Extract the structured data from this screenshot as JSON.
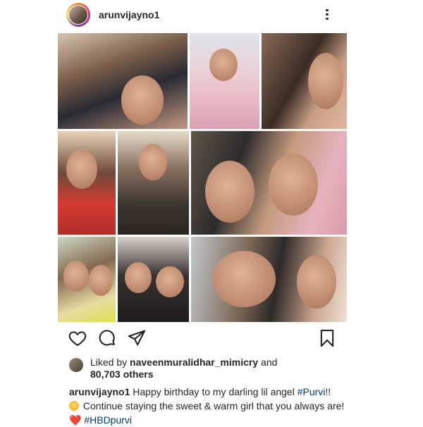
{
  "post": {
    "username": "arunvijayno1",
    "liked_by_prefix": "Liked by",
    "liked_by_user": "naveenmuralidhar_mimicry",
    "liked_by_and": "and",
    "others": "80,703 others",
    "caption": {
      "username": "arunvijayno1",
      "text1": "Happy birthday to my darling lil angel",
      "hashtag1": "#Purvi!!",
      "text2": "Continue staying the sweet & warm girl that you always are!",
      "heart": "❤️",
      "hashtag2": "#HBDpurvi"
    }
  },
  "icons": {
    "like": "heart-icon",
    "comment": "comment-icon",
    "share": "paper-plane-icon",
    "save": "bookmark-icon",
    "more": "more-vertical-icon",
    "emoji": "kissing-face-emoji"
  },
  "colors": {
    "text": "#262626",
    "hashtag": "#00376b",
    "heart": "#ed1c24"
  }
}
